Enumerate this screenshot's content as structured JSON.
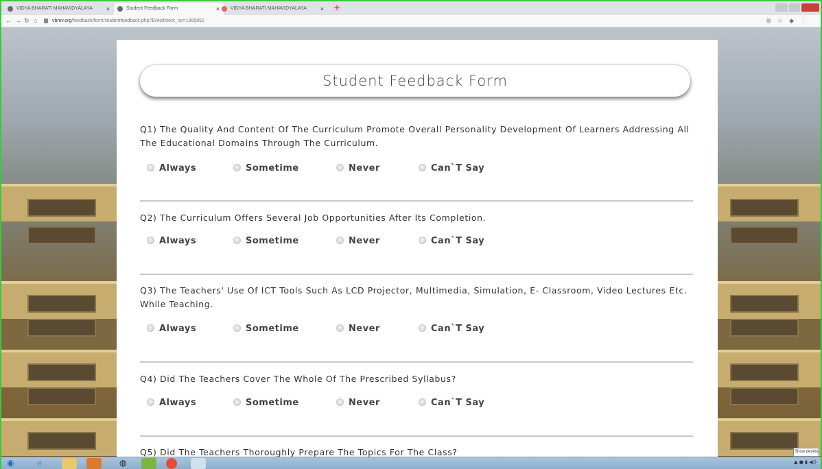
{
  "browser": {
    "tabs": [
      {
        "label": "VIDYA BHARATI MAHAVIDYALAYA",
        "active": false
      },
      {
        "label": "Student Feedback Form",
        "active": true
      },
      {
        "label": "VIDYA BHARATI MAHAVIDYALAYA",
        "active": false
      }
    ],
    "url_host": "vbmv.org",
    "url_path": "/feedback/form/studentfeedback.php?Enrollment_no=1995951"
  },
  "form": {
    "title": "Student Feedback Form",
    "option_labels": [
      "Always",
      "Sometime",
      "Never",
      "Can`T Say"
    ],
    "questions": [
      {
        "text": "Q1) The Quality And Content Of The Curriculum Promote Overall Personality Development Of Learners Addressing All The Educational Domains Through The Curriculum."
      },
      {
        "text": "Q2) The Curriculum Offers Several Job Opportunities After Its Completion."
      },
      {
        "text": "Q3) The Teachers' Use Of ICT Tools Such As LCD Projector, Multimedia, Simulation, E- Classroom, Video Lectures Etc. While Teaching."
      },
      {
        "text": "Q4) Did The Teachers Cover The Whole Of The Prescribed Syllabus?"
      },
      {
        "text": "Q5) Did The Teachers Thoroughly Prepare The Topics For The Class?"
      }
    ]
  },
  "taskbar": {
    "tooltip": "Show desktop"
  },
  "colors": {
    "window_border": "#3ec63e",
    "panel_bg": "#ffffff",
    "separator": "#c9c9c9"
  }
}
